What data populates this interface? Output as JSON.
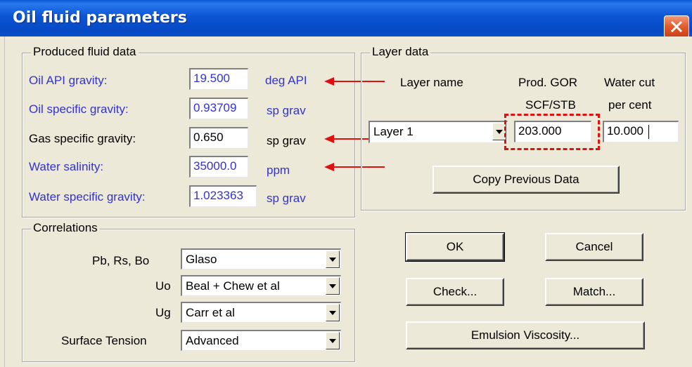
{
  "window": {
    "title": "Oil fluid parameters"
  },
  "produced": {
    "group_title": "Produced fluid data",
    "rows": [
      {
        "label": "Oil API gravity:",
        "value": "19.500",
        "unit": "deg API"
      },
      {
        "label": "Oil specific gravity:",
        "value": "0.93709",
        "unit": "sp grav"
      },
      {
        "label": "Gas specific gravity:",
        "value": "0.650",
        "unit": "sp grav"
      },
      {
        "label": "Water salinity:",
        "value": "35000.0",
        "unit": "ppm"
      },
      {
        "label": "Water specific gravity:",
        "value": "1.023363",
        "unit": "sp grav"
      }
    ]
  },
  "layer": {
    "group_title": "Layer data",
    "col_layer_name": "Layer name",
    "col_gor_line1": "Prod. GOR",
    "col_gor_line2": "SCF/STB",
    "col_wc_line1": "Water cut",
    "col_wc_line2": "per cent",
    "layer_select": "Layer 1",
    "gor_value": "203.000",
    "wc_value": "10.000",
    "copy_button": "Copy Previous Data"
  },
  "correlations": {
    "group_title": "Correlations",
    "rows": [
      {
        "label": "Pb, Rs, Bo",
        "value": "Glaso"
      },
      {
        "label": "Uo",
        "value": "Beal + Chew et al"
      },
      {
        "label": "Ug",
        "value": "Carr et al"
      },
      {
        "label": "Surface Tension",
        "value": "Advanced"
      }
    ]
  },
  "buttons": {
    "ok": "OK",
    "cancel": "Cancel",
    "check": "Check...",
    "match": "Match...",
    "emulsion": "Emulsion Viscosity..."
  },
  "colors": {
    "title_bar": "#0b55d4",
    "blue_label": "#3333cc",
    "annotation_red": "#e01010"
  },
  "icons": [
    "close-icon",
    "dropdown-arrow-icon",
    "red-arrow-icon"
  ]
}
